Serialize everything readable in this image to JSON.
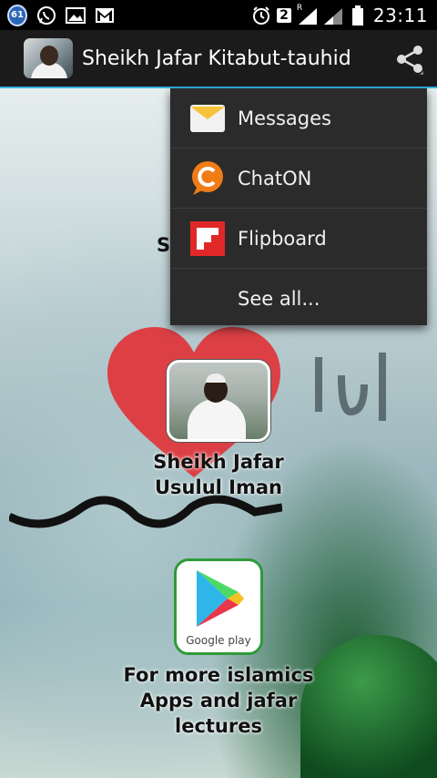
{
  "status_bar": {
    "notification_count": "61",
    "sim_number": "2",
    "roaming": "R",
    "time": "23:11"
  },
  "action_bar": {
    "title": "Sheikh Jafar Kitabut-tauhid",
    "app_icon": "sheikh-photo-icon",
    "share_icon": "share-icon"
  },
  "share_menu": {
    "items": [
      {
        "label": "Messages",
        "icon": "messages-icon"
      },
      {
        "label": "ChatON",
        "icon": "chaton-icon"
      },
      {
        "label": "Flipboard",
        "icon": "flipboard-icon"
      },
      {
        "label": "See all...",
        "icon": ""
      }
    ]
  },
  "content": {
    "partial_label": "S",
    "tiles": [
      {
        "label_line1": "Sheikh Jafar",
        "label_line2": "Usulul Iman",
        "icon": "lecture-thumbnail"
      },
      {
        "label_line1": "For more islamics",
        "label_line2": "Apps and jafar",
        "label_line3": "lectures",
        "icon": "google-play-icon",
        "store_text": "Google play"
      }
    ]
  },
  "colors": {
    "accent": "#33b5e5",
    "actionbar_bg": "#1b1b1b",
    "menu_bg": "#2b2b2b",
    "heart": "#e0343a",
    "flipboard": "#e12828",
    "chaton": "#f07c16"
  }
}
